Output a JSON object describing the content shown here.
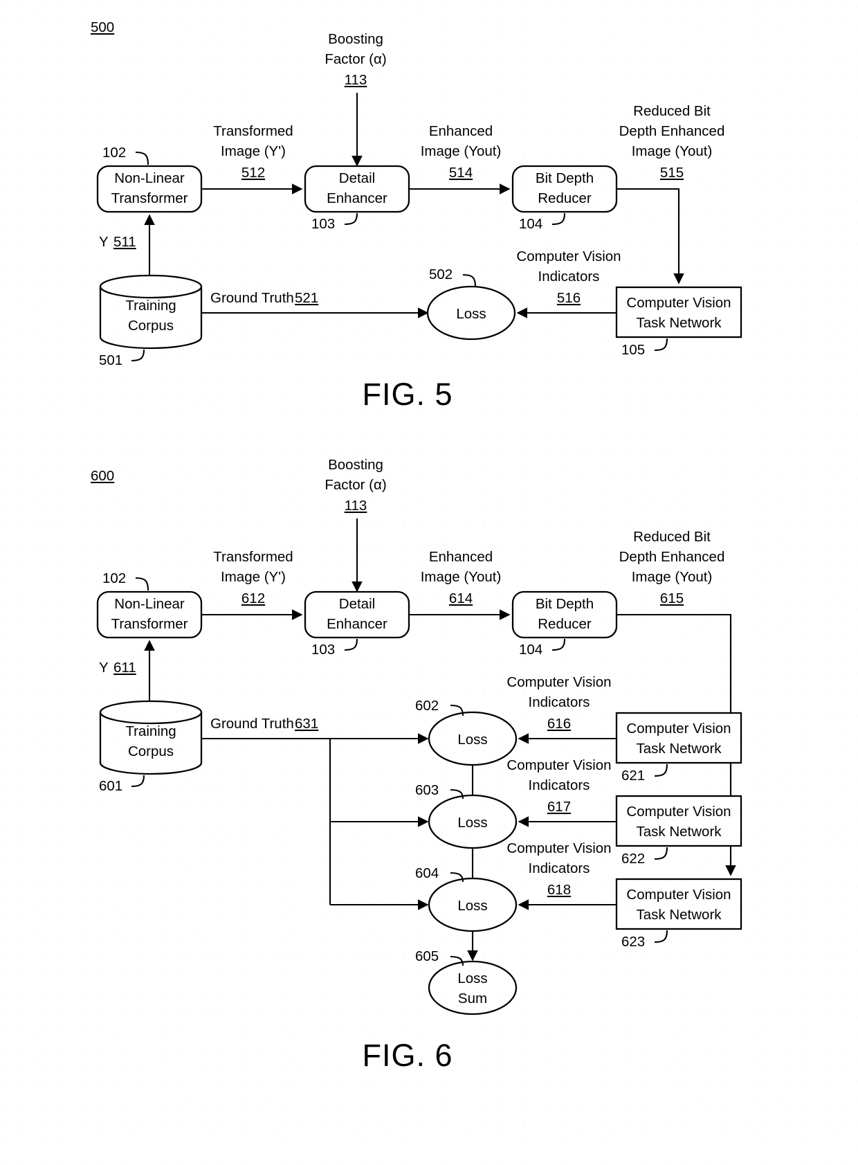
{
  "figures": [
    {
      "id": "fig5",
      "ref": "500",
      "caption": "FIG. 5",
      "boxes": {
        "nonlinear_transformer": "Non-Linear\nTransformer",
        "nonlinear_transformer_l1": "Non-Linear",
        "nonlinear_transformer_l2": "Transformer",
        "nonlinear_transformer_ref": "102",
        "detail_enhancer_l1": "Detail",
        "detail_enhancer_l2": "Enhancer",
        "detail_enhancer_ref": "103",
        "bit_depth_reducer_l1": "Bit Depth",
        "bit_depth_reducer_l2": "Reducer",
        "bit_depth_reducer_ref": "104",
        "cv_task_network_l1": "Computer Vision",
        "cv_task_network_l2": "Task Network",
        "cv_task_network_ref": "105",
        "training_corpus_l1": "Training",
        "training_corpus_l2": "Corpus",
        "training_corpus_ref": "501",
        "loss": "Loss",
        "loss_ref": "502"
      },
      "edges": {
        "boosting_factor_l1": "Boosting",
        "boosting_factor_l2": "Factor (α)",
        "boosting_factor_num": "113",
        "transformed_image_l1": "Transformed",
        "transformed_image_l2": "Image (Y')",
        "transformed_image_num": "512",
        "enhanced_image_l1": "Enhanced",
        "enhanced_image_l2": "Image (Yout)",
        "enhanced_image_num": "514",
        "reduced_bit_l1": "Reduced Bit",
        "reduced_bit_l2": "Depth Enhanced",
        "reduced_bit_l3": "Image (Yout)",
        "reduced_bit_num": "515",
        "y_label": "Y",
        "y_num": "511",
        "ground_truth_label": "Ground Truth",
        "ground_truth_num": "521",
        "cv_indicators_l1": "Computer Vision",
        "cv_indicators_l2": "Indicators",
        "cv_indicators_num": "516"
      }
    },
    {
      "id": "fig6",
      "ref": "600",
      "caption": "FIG. 6",
      "boxes": {
        "nonlinear_transformer_l1": "Non-Linear",
        "nonlinear_transformer_l2": "Transformer",
        "nonlinear_transformer_ref": "102",
        "detail_enhancer_l1": "Detail",
        "detail_enhancer_l2": "Enhancer",
        "detail_enhancer_ref": "103",
        "bit_depth_reducer_l1": "Bit Depth",
        "bit_depth_reducer_l2": "Reducer",
        "bit_depth_reducer_ref": "104",
        "training_corpus_l1": "Training",
        "training_corpus_l2": "Corpus",
        "training_corpus_ref": "601",
        "cv_task_network_1_l1": "Computer Vision",
        "cv_task_network_1_l2": "Task Network",
        "cv_task_network_1_ref": "621",
        "cv_task_network_2_l1": "Computer Vision",
        "cv_task_network_2_l2": "Task Network",
        "cv_task_network_2_ref": "622",
        "cv_task_network_3_l1": "Computer Vision",
        "cv_task_network_3_l2": "Task Network",
        "cv_task_network_3_ref": "623",
        "loss_1": "Loss",
        "loss_1_ref": "602",
        "loss_2": "Loss",
        "loss_2_ref": "603",
        "loss_3": "Loss",
        "loss_3_ref": "604",
        "loss_sum_l1": "Loss",
        "loss_sum_l2": "Sum",
        "loss_sum_ref": "605"
      },
      "edges": {
        "boosting_factor_l1": "Boosting",
        "boosting_factor_l2": "Factor (α)",
        "boosting_factor_num": "113",
        "transformed_image_l1": "Transformed",
        "transformed_image_l2": "Image (Y')",
        "transformed_image_num": "612",
        "enhanced_image_l1": "Enhanced",
        "enhanced_image_l2": "Image (Yout)",
        "enhanced_image_num": "614",
        "reduced_bit_l1": "Reduced Bit",
        "reduced_bit_l2": "Depth Enhanced",
        "reduced_bit_l3": "Image (Yout)",
        "reduced_bit_num": "615",
        "y_label": "Y",
        "y_num": "611",
        "ground_truth_label": "Ground Truth",
        "ground_truth_num": "631",
        "cv_indicators_1_l1": "Computer Vision",
        "cv_indicators_1_l2": "Indicators",
        "cv_indicators_1_num": "616",
        "cv_indicators_2_l1": "Computer Vision",
        "cv_indicators_2_l2": "Indicators",
        "cv_indicators_2_num": "617",
        "cv_indicators_3_l1": "Computer Vision",
        "cv_indicators_3_l2": "Indicators",
        "cv_indicators_3_num": "618"
      }
    }
  ]
}
